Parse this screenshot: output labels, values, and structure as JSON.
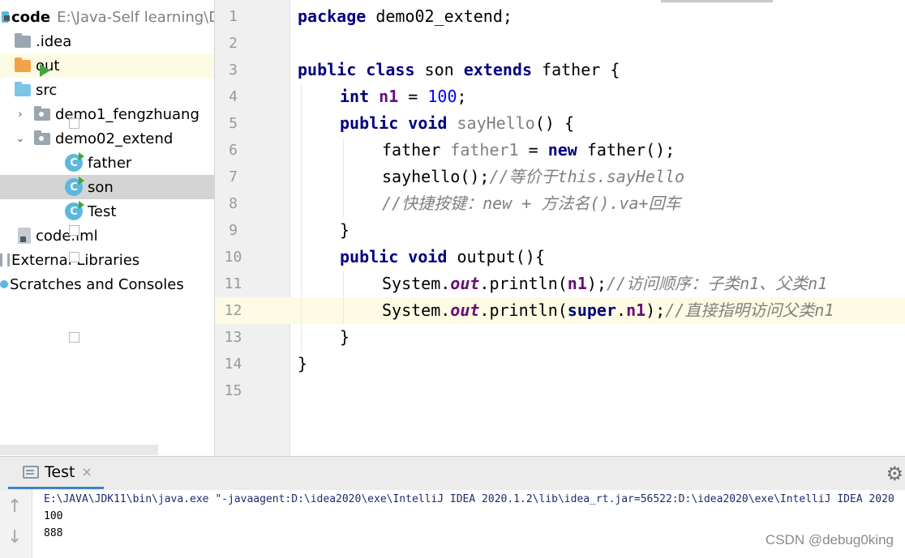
{
  "project": {
    "root": {
      "name": "code",
      "path": "E:\\Java-Self learning\\Da"
    },
    "items": [
      {
        "label": ".idea"
      },
      {
        "label": "out"
      },
      {
        "label": "src"
      },
      {
        "label": "demo1_fengzhuang"
      },
      {
        "label": "demo02_extend"
      },
      {
        "label": "father"
      },
      {
        "label": "son"
      },
      {
        "label": "Test"
      },
      {
        "label": "code.iml"
      },
      {
        "label": "External Libraries"
      },
      {
        "label": "Scratches and Consoles"
      }
    ]
  },
  "editor": {
    "line_numbers": [
      "1",
      "2",
      "3",
      "4",
      "5",
      "6",
      "7",
      "8",
      "9",
      "10",
      "11",
      "12",
      "13",
      "14",
      "15"
    ],
    "lines": [
      {
        "t": [
          "package",
          " demo02_extend;"
        ]
      },
      {
        "t": []
      },
      {
        "t": [
          "public class",
          " son ",
          "extends",
          " father {"
        ]
      },
      {
        "t": [
          "int",
          " ",
          "n1",
          " = ",
          "100",
          ";"
        ]
      },
      {
        "t": [
          "public void",
          " ",
          "sayHello",
          "() {"
        ]
      },
      {
        "t": [
          "father ",
          "father1",
          " = ",
          "new",
          " father();"
        ]
      },
      {
        "t": [
          "sayhello();",
          "//等价于this.sayHello"
        ]
      },
      {
        "t": [
          "//快捷按键：new + 方法名().va+回车"
        ]
      },
      {
        "t": [
          "}"
        ]
      },
      {
        "t": [
          "public void",
          " output(){"
        ]
      },
      {
        "t": [
          "System.",
          "out",
          ".println(",
          "n1",
          ");",
          "//访问顺序：子类n1、父类n1"
        ]
      },
      {
        "t": [
          "System.",
          "out",
          ".println(",
          "super",
          ".",
          "n1",
          ");",
          "//直接指明访问父类n1"
        ]
      },
      {
        "t": [
          "}"
        ]
      },
      {
        "t": [
          "}"
        ]
      },
      {
        "t": []
      }
    ]
  },
  "run": {
    "tab_label": "Test",
    "close_glyph": "×",
    "output": [
      "E:\\JAVA\\JDK11\\bin\\java.exe \"-javaagent:D:\\idea2020\\exe\\IntelliJ IDEA 2020.1.2\\lib\\idea_rt.jar=56522:D:\\idea2020\\exe\\IntelliJ IDEA 2020",
      "100",
      "888"
    ]
  },
  "watermark": "CSDN @debug0king",
  "icons": {
    "gear": "⚙",
    "up": "↑",
    "down": "↓",
    "expand": "›",
    "collapse": "⌄",
    "class_letter": "C"
  }
}
